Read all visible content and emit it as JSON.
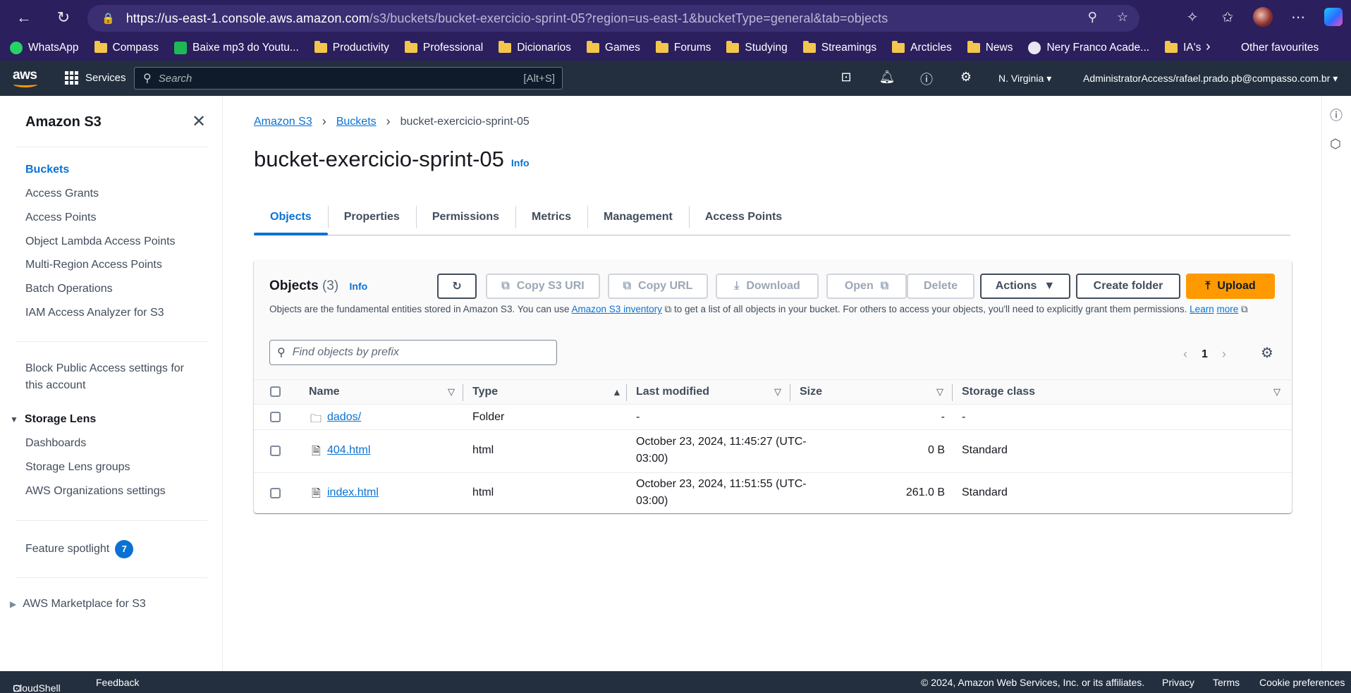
{
  "browser": {
    "url_host": "https://us-east-1.console.aws.amazon.com",
    "url_path": "/s3/buckets/bucket-exercicio-sprint-05?region=us-east-1&bucketType=general&tab=objects",
    "bookmarks": [
      "WhatsApp",
      "Compass",
      "Baixe mp3 do Youtu...",
      "Productivity",
      "Professional",
      "Dicionarios",
      "Games",
      "Forums",
      "Studying",
      "Streamings",
      "Arcticles",
      "News",
      "Nery Franco Acade...",
      "IA's"
    ],
    "other_favourites": "Other favourites"
  },
  "aws_nav": {
    "logo": "aws",
    "services": "Services",
    "search_placeholder": "Search",
    "search_shortcut": "[Alt+S]",
    "region": "N. Virginia",
    "account": "AdministratorAccess/rafael.prado.pb@compasso.com.br"
  },
  "sidebar": {
    "title": "Amazon S3",
    "items": [
      "Buckets",
      "Access Grants",
      "Access Points",
      "Object Lambda Access Points",
      "Multi-Region Access Points",
      "Batch Operations",
      "IAM Access Analyzer for S3"
    ],
    "block_public_line1": "Block Public Access settings for",
    "block_public_line2": "this account",
    "storage_lens": "Storage Lens",
    "storage_lens_items": [
      "Dashboards",
      "Storage Lens groups",
      "AWS Organizations settings"
    ],
    "feature_spotlight": "Feature spotlight",
    "feature_badge": "7",
    "marketplace": "AWS Marketplace for S3"
  },
  "breadcrumb": {
    "s3": "Amazon S3",
    "buckets": "Buckets",
    "current": "bucket-exercicio-sprint-05"
  },
  "page": {
    "title": "bucket-exercicio-sprint-05",
    "info": "Info"
  },
  "tabs": [
    "Objects",
    "Properties",
    "Permissions",
    "Metrics",
    "Management",
    "Access Points"
  ],
  "objects_panel": {
    "title": "Objects",
    "count": "(3)",
    "info": "Info",
    "buttons": {
      "copy_uri": "Copy S3 URI",
      "copy_url": "Copy URL",
      "download": "Download",
      "open": "Open",
      "delete": "Delete",
      "actions": "Actions",
      "create_folder": "Create folder",
      "upload": "Upload"
    },
    "desc_before": "Objects are the fundamental entities stored in Amazon S3. You can use ",
    "desc_link": "Amazon S3 inventory",
    "desc_after": " to get a list of all objects in your bucket. For others to access your objects, you'll need to explicitly grant them permissions. ",
    "desc_learn_1": "Learn",
    "desc_learn_2": "more",
    "filter_placeholder": "Find objects by prefix",
    "page_number": "1",
    "columns": [
      "Name",
      "Type",
      "Last modified",
      "Size",
      "Storage class"
    ],
    "rows": [
      {
        "name": "dados/",
        "type": "Folder",
        "modified_1": "-",
        "modified_2": "",
        "size": "-",
        "storage": "-"
      },
      {
        "name": "404.html",
        "type": "html",
        "modified_1": "October 23, 2024, 11:45:27 (UTC-",
        "modified_2": "03:00)",
        "size": "0 B",
        "storage": "Standard"
      },
      {
        "name": "index.html",
        "type": "html",
        "modified_1": "October 23, 2024, 11:51:55 (UTC-",
        "modified_2": "03:00)",
        "size": "261.0 B",
        "storage": "Standard"
      }
    ]
  },
  "footer": {
    "cloudshell": "CloudShell",
    "feedback": "Feedback",
    "copyright": "© 2024, Amazon Web Services, Inc. or its affiliates.",
    "privacy": "Privacy",
    "terms": "Terms",
    "cookies": "Cookie preferences"
  }
}
